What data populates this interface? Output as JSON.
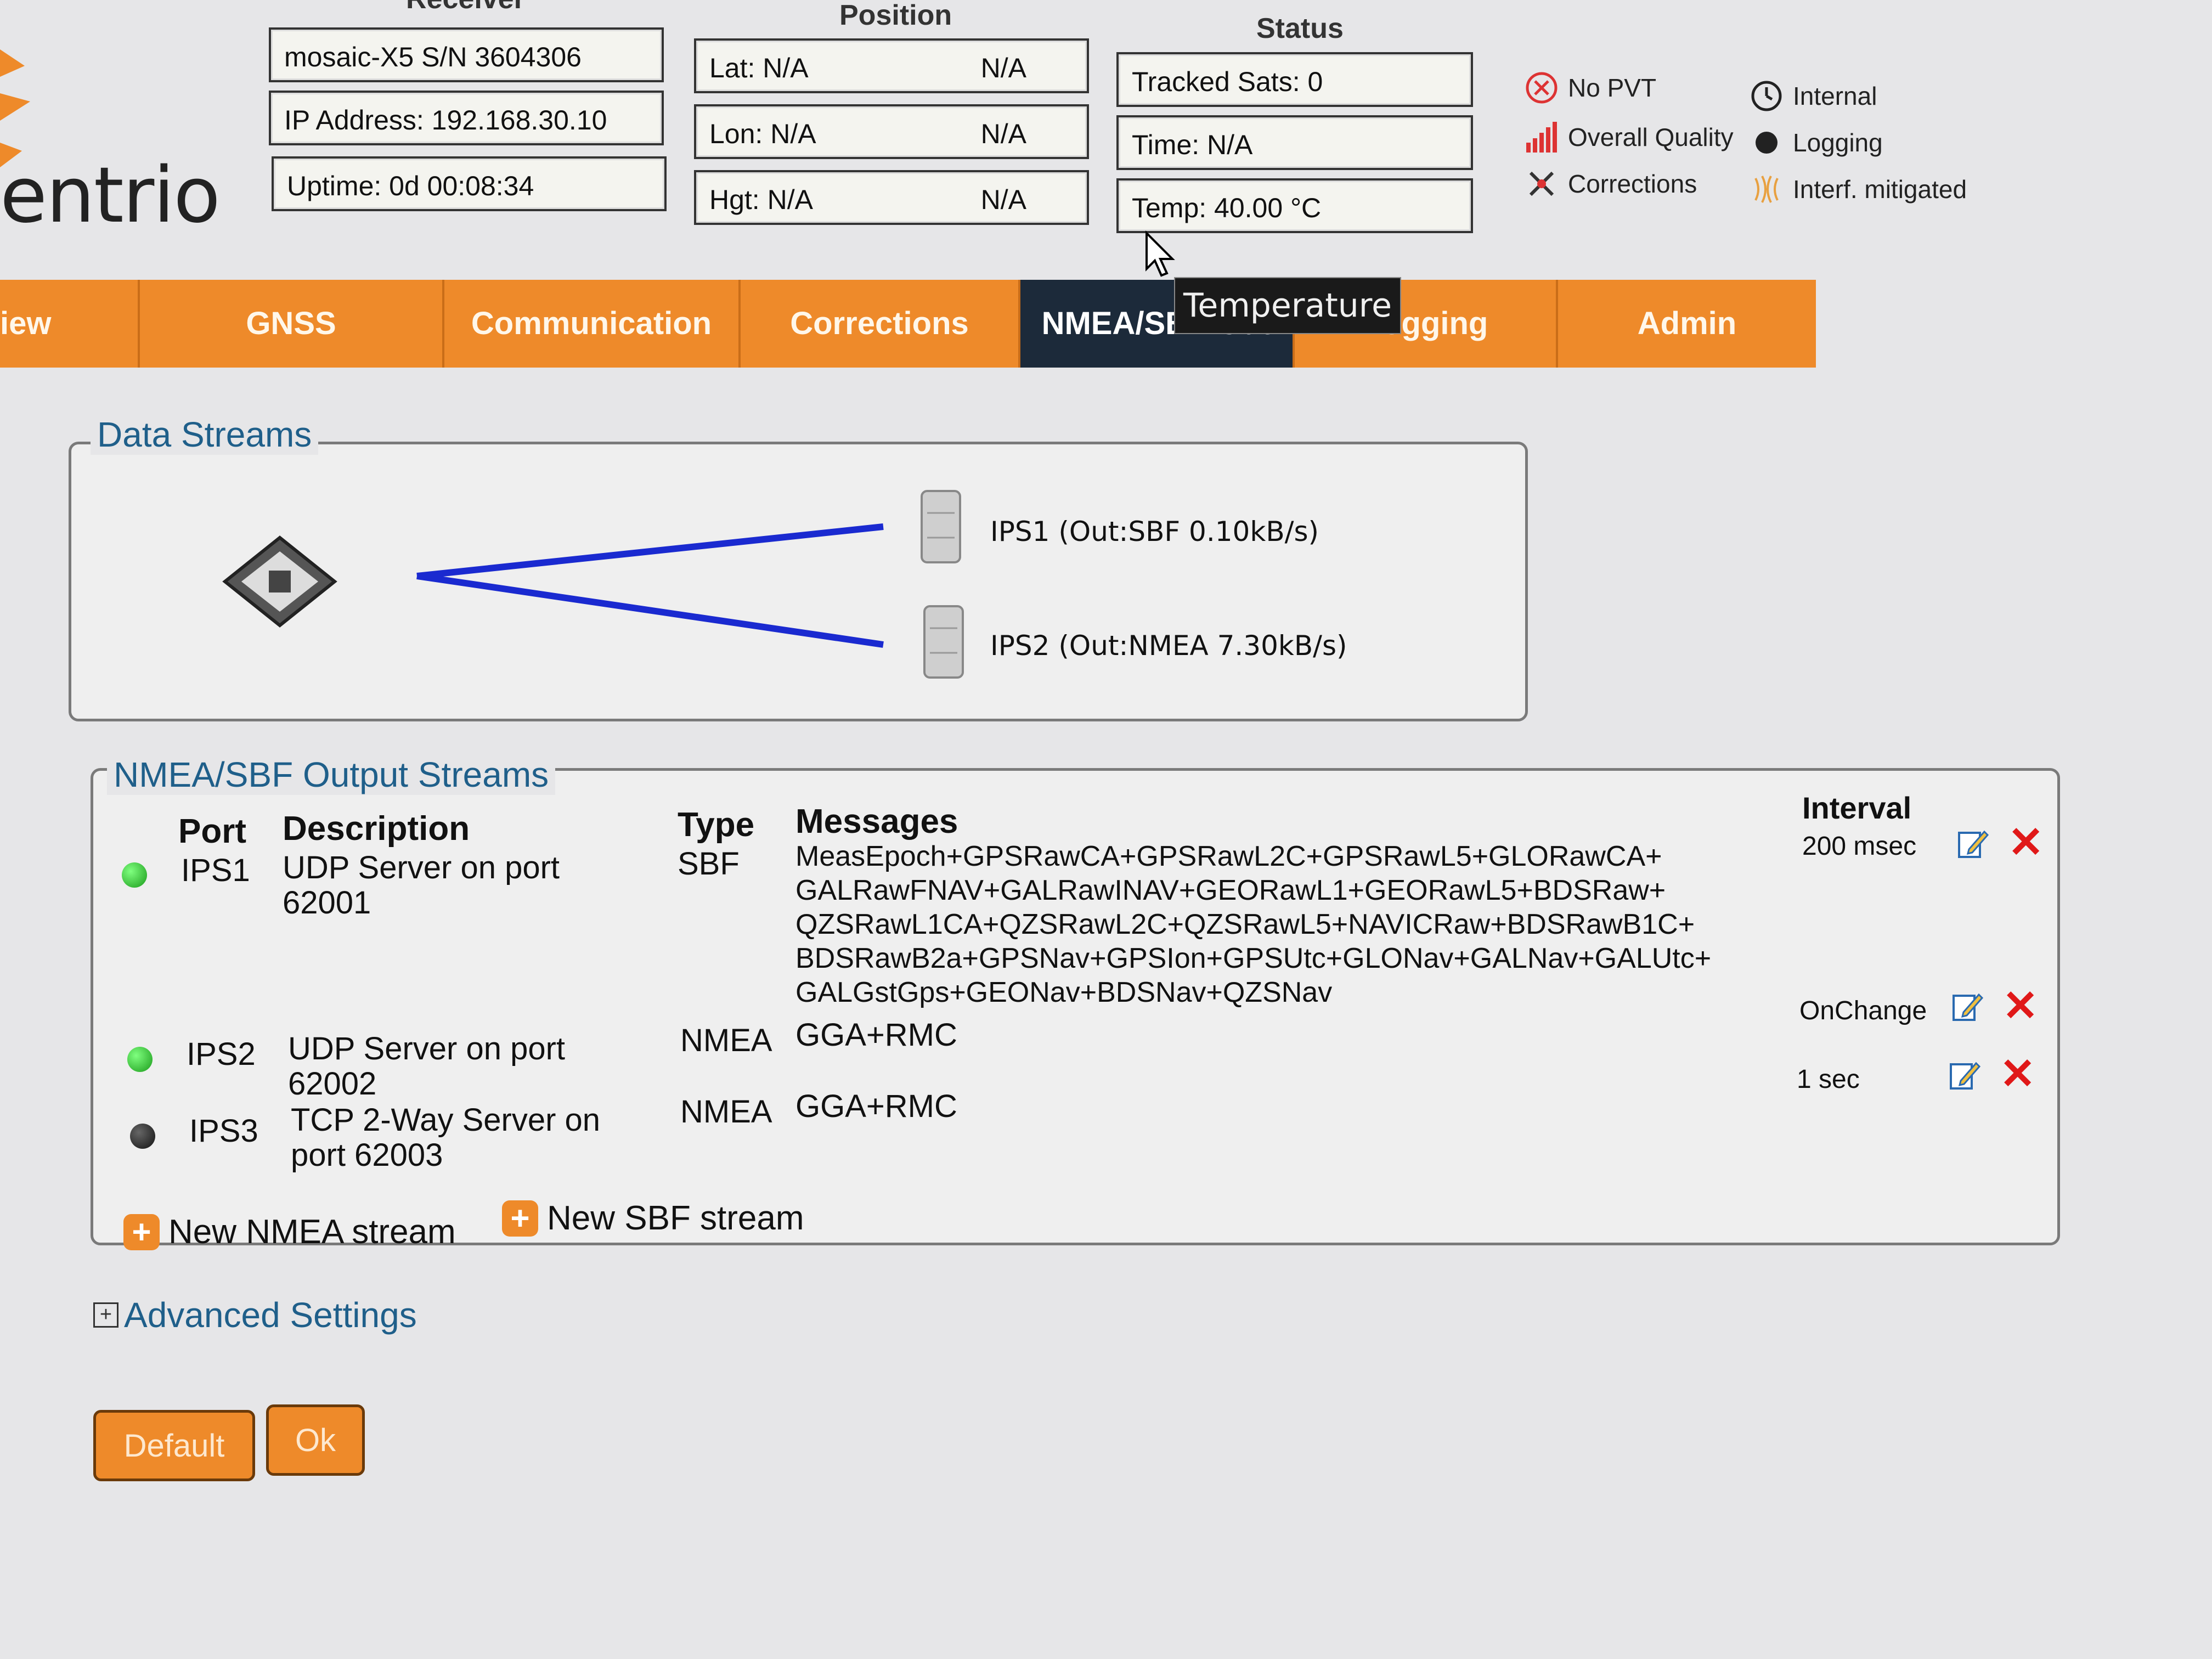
{
  "header": {
    "logo_text": "entrio",
    "receiver_label": "Receiver",
    "position_label": "Position",
    "status_label": "Status",
    "receiver": [
      "mosaic-X5 S/N 3604306",
      "IP Address: 192.168.30.10",
      "Uptime: 0d 00:08:34"
    ],
    "position": [
      {
        "label": "Lat:  N/A",
        "value": "N/A"
      },
      {
        "label": "Lon: N/A",
        "value": "N/A"
      },
      {
        "label": "Hgt:  N/A",
        "value": "N/A"
      }
    ],
    "status": [
      "Tracked Sats: 0",
      "Time: N/A",
      "Temp: 40.00 °C"
    ],
    "legend": [
      "No PVT",
      "Overall Quality",
      "Corrections",
      "Internal",
      "Logging",
      "Interf. mitigated"
    ]
  },
  "nav": {
    "tabs": [
      "iew",
      "GNSS",
      "Communication",
      "Corrections",
      "NMEA/SBF Out",
      "Logging",
      "Admin"
    ],
    "active": "NMEA/SBF Out",
    "tooltip": "Temperature"
  },
  "data_streams": {
    "title": "Data Streams",
    "streams": [
      "IPS1 (Out:SBF 0.10kB/s)",
      "IPS2 (Out:NMEA 7.30kB/s)"
    ]
  },
  "output_streams": {
    "title": "NMEA/SBF Output Streams",
    "headers": {
      "port": "Port",
      "description": "Description",
      "type": "Type",
      "messages": "Messages",
      "interval": "Interval"
    },
    "rows": [
      {
        "status": "green",
        "port": "IPS1",
        "description": [
          "UDP Server on port",
          "62001"
        ],
        "type": "SBF",
        "messages": [
          "MeasEpoch+GPSRawCA+GPSRawL2C+GPSRawL5+GLORawCA+",
          "GALRawFNAV+GALRawINAV+GEORawL1+GEORawL5+BDSRaw+",
          "QZSRawL1CA+QZSRawL2C+QZSRawL5+NAVICRaw+BDSRawB1C+",
          "BDSRawB2a+GPSNav+GPSIon+GPSUtc+GLONav+GALNav+GALUtc+",
          "GALGstGps+GEONav+BDSNav+QZSNav"
        ],
        "interval": "200 msec"
      },
      {
        "status": "green",
        "port": "IPS2",
        "description": [
          "UDP Server on port",
          "62002"
        ],
        "type": "NMEA",
        "messages": [
          "GGA+RMC"
        ],
        "interval": "OnChange"
      },
      {
        "status": "dark",
        "port": "IPS3",
        "description": [
          "TCP 2-Way Server on",
          "port 62003"
        ],
        "type": "NMEA",
        "messages": [
          "GGA+RMC"
        ],
        "interval": "1 sec"
      }
    ],
    "add_nmea": "New NMEA stream",
    "add_sbf": "New SBF stream"
  },
  "advanced": "Advanced Settings",
  "buttons": {
    "default": "Default",
    "ok": "Ok"
  },
  "colors": {
    "accent": "#ee8a2a",
    "active_tab": "#1c2a3a",
    "link": "#1f5f8a",
    "stream_line": "#1a2ad0"
  }
}
